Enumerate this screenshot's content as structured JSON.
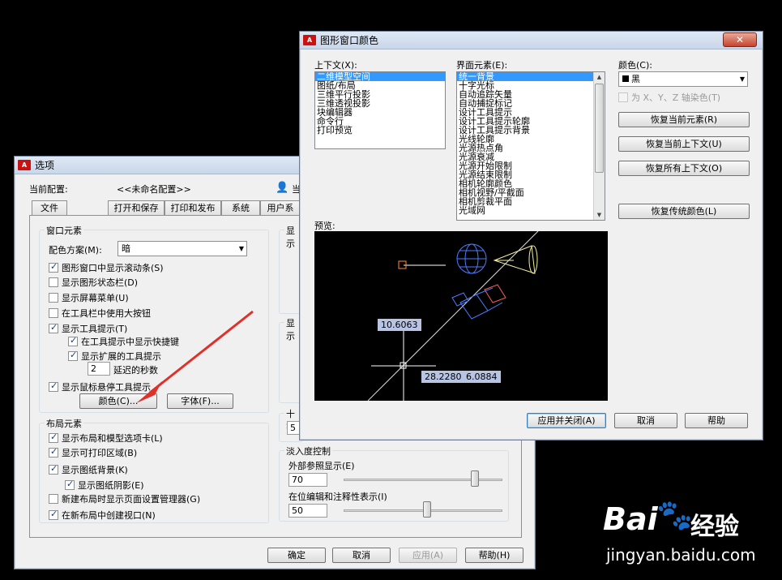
{
  "options_dialog": {
    "title": "选项",
    "profile_label": "当前配置:",
    "profile_value": "<<未命名配置>>",
    "profile_right": "当",
    "tabs": [
      "文件",
      "显示",
      "打开和保存",
      "打印和发布",
      "系统",
      "用户系"
    ],
    "window_elements": {
      "title": "窗口元素",
      "color_scheme_label": "配色方案(M):",
      "color_scheme_value": "暗",
      "checks": [
        {
          "label": "图形窗口中显示滚动条(S)",
          "checked": true
        },
        {
          "label": "显示图形状态栏(D)",
          "checked": false
        },
        {
          "label": "显示屏幕菜单(U)",
          "checked": false
        },
        {
          "label": "在工具栏中使用大按钮",
          "checked": false
        },
        {
          "label": "显示工具提示(T)",
          "checked": true
        },
        {
          "label": "在工具提示中显示快捷键",
          "checked": true
        },
        {
          "label": "显示扩展的工具提示",
          "checked": true
        }
      ],
      "delay_value": "2",
      "delay_label": "延迟的秒数",
      "hover_tooltip": {
        "label": "显示鼠标悬停工具提示",
        "checked": true
      },
      "colors_button": "颜色(C)...",
      "fonts_button": "字体(F)..."
    },
    "layout_elements": {
      "title": "布局元素",
      "checks": [
        {
          "label": "显示布局和模型选项卡(L)",
          "checked": true
        },
        {
          "label": "显示可打印区域(B)",
          "checked": true
        },
        {
          "label": "显示图纸背景(K)",
          "checked": true
        },
        {
          "label": "显示图纸阴影(E)",
          "checked": true
        },
        {
          "label": "新建布局时显示页面设置管理器(G)",
          "checked": false
        },
        {
          "label": "在新布局中创建视口(N)",
          "checked": true
        }
      ]
    },
    "right_group_titles": [
      "显示",
      "显示",
      "十字"
    ],
    "right_value": "5",
    "fade": {
      "title": "淡入度控制",
      "xref_label": "外部参照显示(E)",
      "xref_value": "70",
      "xref_level": 70,
      "inplace_label": "在位编辑和注释性表示(I)",
      "inplace_value": "50",
      "inplace_level": 50
    },
    "buttons": {
      "ok": "确定",
      "cancel": "取消",
      "apply": "应用(A)",
      "help": "帮助(H)"
    }
  },
  "color_dialog": {
    "title": "图形窗口颜色",
    "context_label": "上下文(X):",
    "context_items": [
      "二维模型空间",
      "图纸/布局",
      "三维平行投影",
      "三维透视投影",
      "块编辑器",
      "命令行",
      "打印预览"
    ],
    "element_label": "界面元素(E):",
    "element_items": [
      "统一背景",
      "十字光标",
      "自动追踪矢量",
      "自动捕捉标记",
      "设计工具提示",
      "设计工具提示轮廓",
      "设计工具提示背景",
      "光线轮廓",
      "光源热点角",
      "光源衰减",
      "光源开始限制",
      "光源结束限制",
      "相机轮廓颜色",
      "相机视野/平截面",
      "相机剪裁平面",
      "光域网"
    ],
    "color_label": "颜色(C):",
    "color_value": "黑",
    "tint_label": "为 X、Y、Z 轴染色(T)",
    "restore_element": "恢复当前元素(R)",
    "restore_context": "恢复当前上下文(U)",
    "restore_all": "恢复所有上下文(O)",
    "restore_classic": "恢复传统颜色(L)",
    "preview_label": "预览:",
    "dims": [
      "10.6063",
      "28.2280",
      "6.0884"
    ],
    "buttons": {
      "apply_close": "应用并关闭(A)",
      "cancel": "取消",
      "help": "帮助"
    }
  },
  "watermark": {
    "brand": "Bai",
    "brand_cn": "经验",
    "url": "jingyan.baidu.com"
  },
  "colors": {
    "accent": "#3399ff",
    "arrow": "#e0302a",
    "preview_bg": "#000000"
  }
}
